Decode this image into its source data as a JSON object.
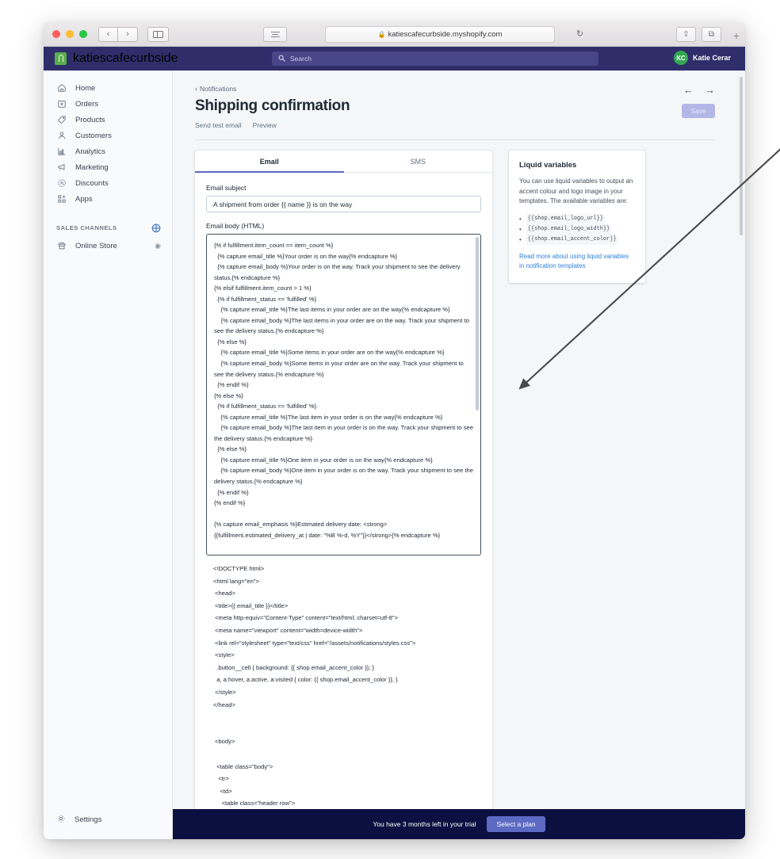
{
  "browser": {
    "url": "katiescafecurbside.myshopify.com",
    "lock_icon": "lock-icon",
    "reader_icon": "reader-view-icon",
    "back_label": "‹",
    "forward_label": "›",
    "reload_label": "↻",
    "share_label": "⇧",
    "tabs_label": "⧉",
    "newtab_label": "+"
  },
  "topbar": {
    "shop_name": "katiescafecurbside",
    "search_placeholder": "Search",
    "search_icon": "search-icon",
    "user_initials": "KC",
    "user_name": "Katie Cerar"
  },
  "sidebar": {
    "items": [
      {
        "label": "Home",
        "icon": "home-icon"
      },
      {
        "label": "Orders",
        "icon": "orders-icon"
      },
      {
        "label": "Products",
        "icon": "products-tag-icon"
      },
      {
        "label": "Customers",
        "icon": "customers-person-icon"
      },
      {
        "label": "Analytics",
        "icon": "analytics-bar-chart-icon"
      },
      {
        "label": "Marketing",
        "icon": "marketing-megaphone-icon"
      },
      {
        "label": "Discounts",
        "icon": "discounts-badge-icon"
      },
      {
        "label": "Apps",
        "icon": "apps-grid-icon"
      }
    ],
    "sales_channels_header": "SALES CHANNELS",
    "add_channel_icon": "plus-circle-icon",
    "channels": [
      {
        "label": "Online Store",
        "icon": "storefront-icon",
        "trailing_icon": "eye-icon"
      }
    ],
    "settings": {
      "label": "Settings",
      "icon": "gear-icon"
    }
  },
  "page": {
    "breadcrumb": "Notifications",
    "breadcrumb_icon": "chevron-left-icon",
    "title": "Shipping confirmation",
    "actions": [
      "Send test email",
      "Preview"
    ],
    "prev_icon": "arrow-left-icon",
    "next_icon": "arrow-right-icon",
    "save_label": "Save"
  },
  "tabs": [
    {
      "label": "Email",
      "active": true
    },
    {
      "label": "SMS",
      "active": false
    }
  ],
  "form": {
    "subject_label": "Email subject",
    "subject_value": "A shipment from order {{ name }} is on the way",
    "body_label": "Email body (HTML)",
    "body_code": "{% if fulfillment.item_count == item_count %}\n  {% capture email_title %}Your order is on the way{% endcapture %}\n  {% capture email_body %}Your order is on the way. Track your shipment to see the delivery status.{% endcapture %}\n{% elsif fulfillment.item_count > 1 %}\n  {% if fulfillment_status == 'fulfilled' %}\n    {% capture email_title %}The last items in your order are on the way{% endcapture %}\n    {% capture email_body %}The last items in your order are on the way. Track your shipment to see the delivery status.{% endcapture %}\n  {% else %}\n    {% capture email_title %}Some items in your order are on the way{% endcapture %}\n    {% capture email_body %}Some items in your order are on the way. Track your shipment to see the delivery status.{% endcapture %}\n  {% endif %}\n{% else %}\n  {% if fulfillment_status == 'fulfilled' %}\n    {% capture email_title %}The last item in your order is on the way{% endcapture %}\n    {% capture email_body %}The last item in your order is on the way. Track your shipment to see the delivery status.{% endcapture %}\n  {% else %}\n    {% capture email_title %}One item in your order is on the way{% endcapture %}\n    {% capture email_body %}One item in your order is on the way. Track your shipment to see the delivery status.{% endcapture %}\n  {% endif %}\n{% endif %}\n\n{% capture email_emphasis %}Estimated delivery date: <strong>{{fulfillment.estimated_delivery_at | date: \"%B %-d, %Y\"}}</strong>{% endcapture %}",
    "body_code_overflow": "<!DOCTYPE html>\n<html lang=\"en\">\n <head>\n <title>{{ email_title }}</title>\n <meta http-equiv=\"Content-Type\" content=\"text/html; charset=utf-8\">\n <meta name=\"viewport\" content=\"width=device-width\">\n <link rel=\"stylesheet\" type=\"text/css\" href=\"/assets/notifications/styles.css\">\n <style>\n  .button__cell { background: {{ shop.email_accent_color }}; }\n  a, a:hover, a:active, a:visited { color: {{ shop.email_accent_color }}; }\n </style>\n</head>\n\n\n <body>\n\n  <table class=\"body\">\n   <tr>\n    <td>\n     <table class=\"header row\">\n<tr>\n <td class=\"header__cell\">"
  },
  "liquid_panel": {
    "title": "Liquid variables",
    "description": "You can use liquid variables to output an accent colour and logo image in your templates. The available variables are:",
    "variables": [
      "{{shop.email_logo_url}}",
      "{{shop.email_logo_width}}",
      "{{shop.email_accent_color}}"
    ],
    "link_text": "Read more about using liquid variables in notification templates"
  },
  "trial": {
    "message": "You have 3 months left in your trial",
    "cta": "Select a plan"
  },
  "colors": {
    "shopify_nav": "#2f2e6b",
    "accent": "#5c6ac4",
    "trial_banner": "#0b1040",
    "link": "#2f7ed8",
    "logo_green": "#5bab4a",
    "avatar_green": "#33a852"
  },
  "annotation": {
    "arrow_icon": "annotation-arrow-icon"
  }
}
